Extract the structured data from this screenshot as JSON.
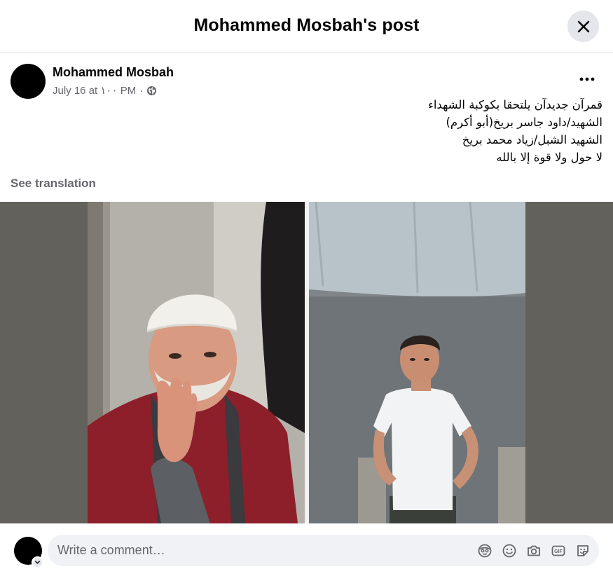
{
  "header": {
    "title": "Mohammed Mosbah's post",
    "close_icon": "close-icon"
  },
  "post": {
    "author": "Mohammed Mosbah",
    "date": "July 16 at ١٠٠ PM",
    "separator": "·",
    "audience_icon": "globe-icon",
    "more_icon": "more-horizontal-icon",
    "text_lines": [
      "قمرآن جديدآن يلتحقا بكوكبة الشهداء",
      "الشهيد/داود جاسر بريخ(أبو أكرم)",
      "الشهيد الشبل/زياد محمد بريخ",
      "لا حول ولا قوة إلا بالله"
    ],
    "see_translation": "See translation",
    "photo": {
      "type": "two-panel collage",
      "panels": [
        "elderly-man-photo",
        "boy-photo"
      ]
    }
  },
  "composer": {
    "placeholder": "Write a comment…",
    "tools": [
      "avatar-sticker-icon",
      "emoji-icon",
      "camera-icon",
      "gif-icon",
      "sticker-icon"
    ]
  },
  "colors": {
    "text_primary": "#050505",
    "text_secondary": "#65676b",
    "surface": "#f0f2f5",
    "button_bg": "#e4e6eb"
  }
}
